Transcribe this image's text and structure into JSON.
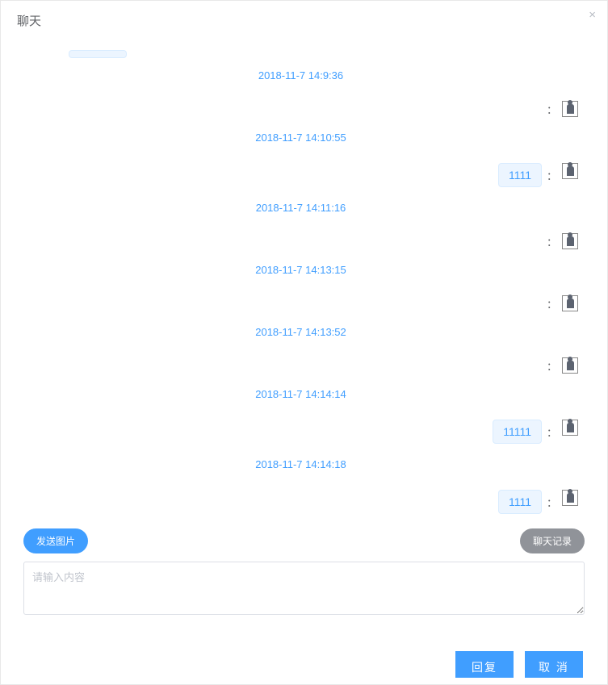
{
  "header": {
    "title": "聊天",
    "close_glyph": "×"
  },
  "messages": [
    {
      "type": "faded"
    },
    {
      "type": "time",
      "text": "2018-11-7 14:9:36"
    },
    {
      "type": "msg",
      "side": "outgoing",
      "text": "",
      "avatar": true
    },
    {
      "type": "time",
      "text": "2018-11-7 14:10:55"
    },
    {
      "type": "msg",
      "side": "outgoing",
      "text": "1111",
      "avatar": true
    },
    {
      "type": "time",
      "text": "2018-11-7 14:11:16"
    },
    {
      "type": "msg",
      "side": "outgoing",
      "text": "",
      "avatar": true
    },
    {
      "type": "time",
      "text": "2018-11-7 14:13:15"
    },
    {
      "type": "msg",
      "side": "outgoing",
      "text": "",
      "avatar": true
    },
    {
      "type": "time",
      "text": "2018-11-7 14:13:52"
    },
    {
      "type": "msg",
      "side": "outgoing",
      "text": "",
      "avatar": true
    },
    {
      "type": "time",
      "text": "2018-11-7 14:14:14"
    },
    {
      "type": "msg",
      "side": "outgoing",
      "text": "11111",
      "avatar": true
    },
    {
      "type": "time",
      "text": "2018-11-7 14:14:18"
    },
    {
      "type": "msg",
      "side": "outgoing",
      "text": "1111",
      "avatar": true
    }
  ],
  "actions": {
    "send_image": "发送图片",
    "history": "聊天记录"
  },
  "input": {
    "placeholder": "请输入内容"
  },
  "footer": {
    "reply": "回复",
    "cancel": "取 消"
  },
  "colon_glyph": "："
}
